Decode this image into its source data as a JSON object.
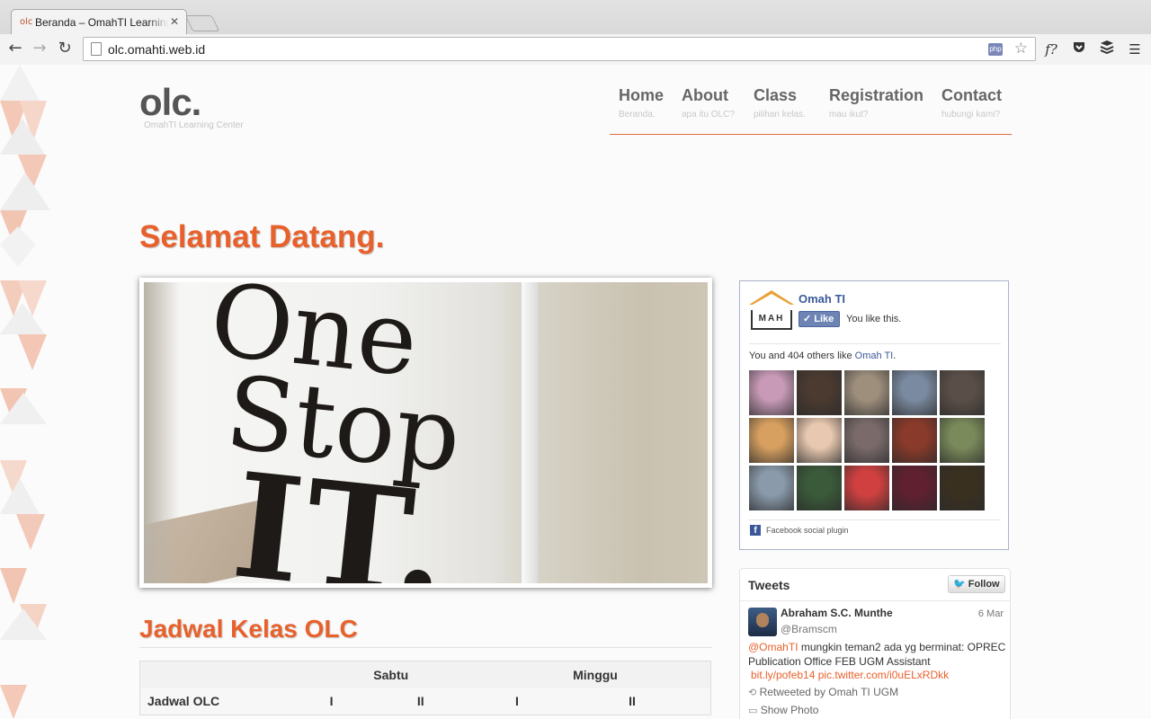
{
  "browser": {
    "tab_title": "Beranda – OmahTI Learning Center",
    "tab_favicon": "olc",
    "url": "olc.omahti.web.id",
    "php_badge": "php",
    "ext_f": "f?"
  },
  "site": {
    "logo": "olc.",
    "logo_sub": "OmahTI Learning Center",
    "nav": [
      {
        "title": "Home",
        "sub": "Beranda."
      },
      {
        "title": "About",
        "sub": "apa itu OLC?"
      },
      {
        "title": "Class",
        "sub": "pilihan kelas."
      },
      {
        "title": "Registration",
        "sub": "mau ikut?"
      },
      {
        "title": "Contact",
        "sub": "hubungi kami?"
      }
    ],
    "welcome": "Selamat Datang.",
    "hero_sign": [
      "One",
      "Stop",
      "IT."
    ]
  },
  "schedule": {
    "title": "Jadwal Kelas OLC",
    "days": [
      "Sabtu",
      "Minggu"
    ],
    "row_label": "Jadwal OLC",
    "sessions": [
      "I",
      "II",
      "I",
      "II"
    ]
  },
  "facebook": {
    "page_name": "Omah TI",
    "logo_text": "MAH",
    "like_label": "Like",
    "like_text": "You like this.",
    "count_prefix": "You and 404 others like",
    "count_link": "Omah TI",
    "count_suffix": ".",
    "plugin_label": "Facebook social plugin",
    "faces_colors": [
      "#c89ab7",
      "#4a3a30",
      "#9e8f7d",
      "#7a8aa0",
      "#5a4f48",
      "#d8a060",
      "#e8c8b0",
      "#7a6a6a",
      "#8a3a2a",
      "#7a8a5a",
      "#8a9aaa",
      "#3a5a3a",
      "#d04040",
      "#602030",
      "#3a3020"
    ]
  },
  "twitter": {
    "title": "Tweets",
    "follow_label": "Follow",
    "author": "Abraham S.C. Munthe",
    "handle": "@Bramscm",
    "date": "6 Mar",
    "mention": "@OmahTI",
    "text": " mungkin teman2 ada yg berminat: OPREC Publication Office FEB UGM Assistant",
    "link1": "bit.ly/pofeb14",
    "link2": "pic.twitter.com/i0uELxRDkk",
    "retweet": "Retweeted by Omah TI UGM",
    "show_photo": "Show Photo"
  },
  "colors": {
    "accent": "#e8612c",
    "facebook": "#3b5998",
    "nav_text": "#666666"
  }
}
